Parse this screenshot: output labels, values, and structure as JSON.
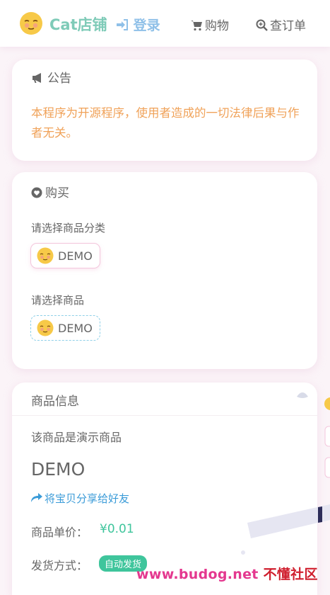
{
  "header": {
    "brand": "Cat店铺",
    "login_label": "登录",
    "nav": [
      {
        "label": "购物",
        "icon": "cart-icon"
      },
      {
        "label": "查订单",
        "icon": "search-icon"
      }
    ]
  },
  "notice": {
    "title": "公告",
    "text": "本程序为开源程序，使用者造成的一切法律后果与作者无关。"
  },
  "buy": {
    "title": "购买",
    "category_label": "请选择商品分类",
    "category_value": "DEMO",
    "product_label": "请选择商品",
    "product_value": "DEMO"
  },
  "product_info": {
    "title": "商品信息",
    "description": "该商品是演示商品",
    "name": "DEMO",
    "share_label": "将宝贝分享给好友",
    "price_label": "商品单价：",
    "price": "¥0.01",
    "delivery_label": "发货方式：",
    "delivery_badge": "自动发货"
  },
  "watermark": {
    "site": "www.budog.net",
    "name": "不懂社区"
  },
  "colors": {
    "brand": "#7fcbb8",
    "login": "#8fc0e8",
    "notice_text": "#f0a259",
    "price": "#3fc59c",
    "share_link": "#3a9bd8"
  }
}
